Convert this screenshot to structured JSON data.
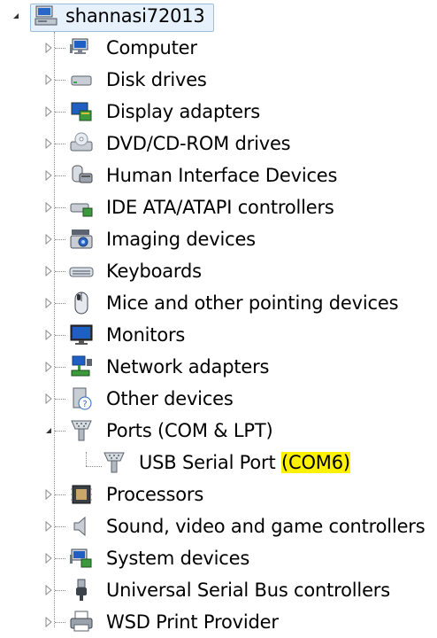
{
  "tree": {
    "root_label": "shannasi72013",
    "categories": [
      {
        "label": "Computer",
        "icon": "computer-icon"
      },
      {
        "label": "Disk drives",
        "icon": "disk-drive-icon"
      },
      {
        "label": "Display adapters",
        "icon": "display-adapter-icon"
      },
      {
        "label": "DVD/CD-ROM drives",
        "icon": "dvd-drive-icon"
      },
      {
        "label": "Human Interface Devices",
        "icon": "hid-icon"
      },
      {
        "label": "IDE ATA/ATAPI controllers",
        "icon": "ide-controller-icon"
      },
      {
        "label": "Imaging devices",
        "icon": "camera-icon"
      },
      {
        "label": "Keyboards",
        "icon": "keyboard-icon"
      },
      {
        "label": "Mice and other pointing devices",
        "icon": "mouse-icon"
      },
      {
        "label": "Monitors",
        "icon": "monitor-icon"
      },
      {
        "label": "Network adapters",
        "icon": "network-adapter-icon"
      },
      {
        "label": "Other devices",
        "icon": "unknown-device-icon"
      },
      {
        "label": "Ports (COM & LPT)",
        "icon": "port-icon",
        "expanded": true
      },
      {
        "label": "Processors",
        "icon": "processor-icon"
      },
      {
        "label": "Sound, video and game controllers",
        "icon": "speaker-icon"
      },
      {
        "label": "System devices",
        "icon": "system-device-icon"
      },
      {
        "label": "Universal Serial Bus controllers",
        "icon": "usb-plug-icon"
      },
      {
        "label": "WSD Print Provider",
        "icon": "printer-icon"
      }
    ],
    "child": {
      "label_main": "USB Serial Port ",
      "label_highlight": "(COM6)",
      "icon": "port-icon"
    }
  },
  "colors": {
    "highlight": "#fff200",
    "selection_border": "#9fbedc",
    "selection_fill": "#e7f1fb"
  }
}
